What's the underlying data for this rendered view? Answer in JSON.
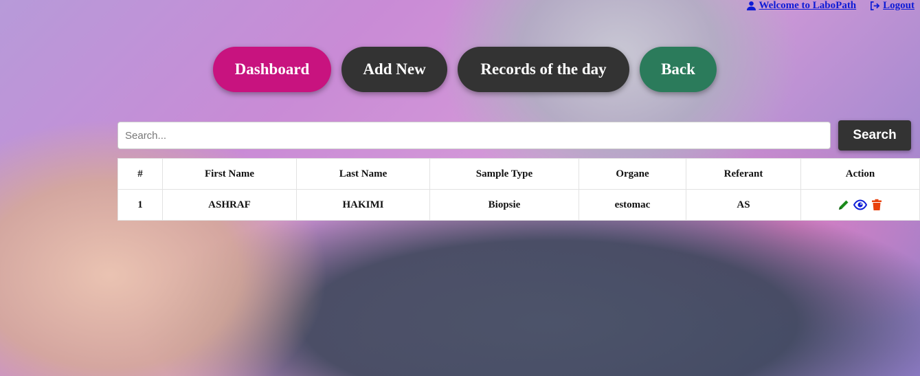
{
  "header": {
    "welcome_label": "Welcome to LaboPath",
    "logout_label": "Logout"
  },
  "nav": {
    "dashboard": "Dashboard",
    "add_new": "Add New",
    "records_of_day": "Records of the day",
    "back": "Back"
  },
  "search": {
    "placeholder": "Search...",
    "value": "",
    "button_label": "Search"
  },
  "table": {
    "columns": [
      "#",
      "First Name",
      "Last Name",
      "Sample Type",
      "Organe",
      "Referant",
      "Action"
    ],
    "rows": [
      {
        "index": "1",
        "first_name": "ASHRAF",
        "last_name": "HAKIMI",
        "sample_type": "Biopsie",
        "organe": "estomac",
        "referant": "AS",
        "actions": [
          "edit-icon",
          "view-icon",
          "delete-icon"
        ]
      }
    ]
  },
  "colors": {
    "dashboard": "#c8137f",
    "dark": "#333333",
    "back": "#2b7b5b",
    "link": "#0d1bd6",
    "edit": "#1a8a1a",
    "view": "#1020d8",
    "delete": "#e8400c"
  }
}
